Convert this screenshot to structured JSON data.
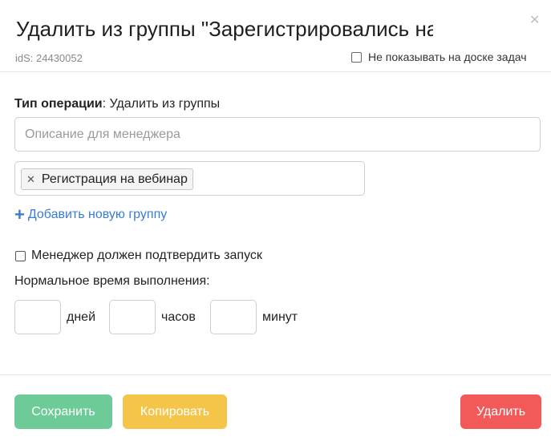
{
  "header": {
    "title": "Удалить из группы \"Зарегистрировались на вебинар\"",
    "ids": "idS: 24430052",
    "close_icon": "close-icon",
    "hide_board_label": "Не показывать на доске задач"
  },
  "operation": {
    "type_label": "Тип операции",
    "type_value": ": Удалить из группы"
  },
  "description": {
    "placeholder": "Описание для менеджера",
    "value": ""
  },
  "groups": {
    "tags": [
      "Регистрация на вебинар"
    ],
    "add_label": "Добавить новую группу"
  },
  "confirm": {
    "label": "Менеджер должен подтвердить запуск",
    "checked": false
  },
  "time": {
    "title": "Нормальное время выполнения:",
    "days_label": "дней",
    "hours_label": "часов",
    "minutes_label": "минут",
    "days": "",
    "hours": "",
    "minutes": ""
  },
  "footer": {
    "save_label": "Сохранить",
    "copy_label": "Копировать",
    "delete_label": "Удалить"
  },
  "colors": {
    "save": "#6ccb96",
    "copy": "#f5c54a",
    "delete": "#f25a5a",
    "link": "#3a7bd5"
  }
}
